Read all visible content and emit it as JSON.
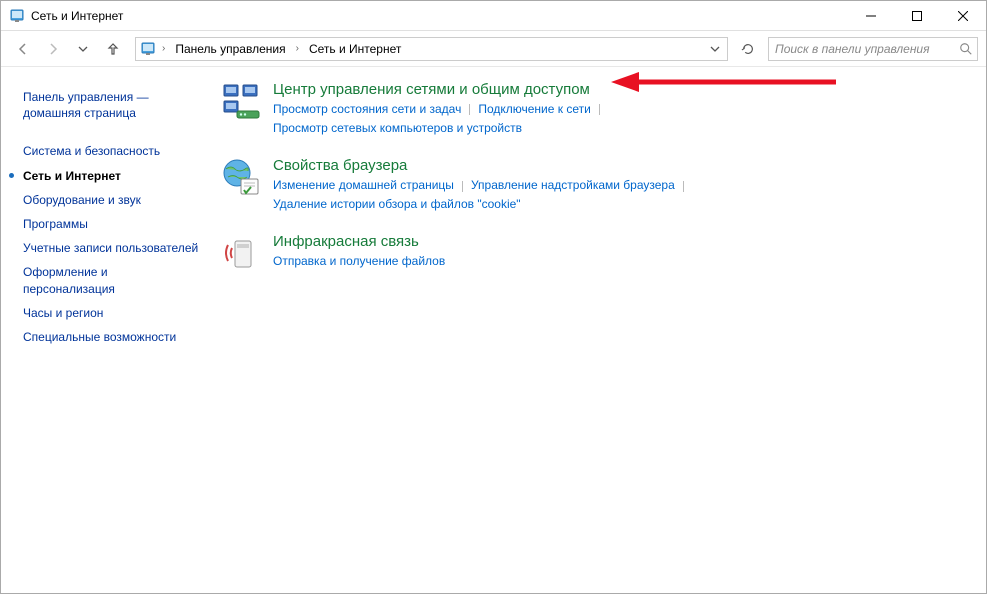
{
  "window": {
    "title": "Сеть и Интернет"
  },
  "breadcrumb": {
    "items": [
      "Панель управления",
      "Сеть и Интернет"
    ]
  },
  "search": {
    "placeholder": "Поиск в панели управления"
  },
  "sidebar": {
    "home": "Панель управления — домашняя страница",
    "items": [
      {
        "label": "Система и безопасность",
        "active": false
      },
      {
        "label": "Сеть и Интернет",
        "active": true
      },
      {
        "label": "Оборудование и звук",
        "active": false
      },
      {
        "label": "Программы",
        "active": false
      },
      {
        "label": "Учетные записи пользователей",
        "active": false
      },
      {
        "label": "Оформление и персонализация",
        "active": false
      },
      {
        "label": "Часы и регион",
        "active": false
      },
      {
        "label": "Специальные возможности",
        "active": false
      }
    ]
  },
  "categories": [
    {
      "title": "Центр управления сетями и общим доступом",
      "links": [
        "Просмотр состояния сети и задач",
        "Подключение к сети",
        "Просмотр сетевых компьютеров и устройств"
      ]
    },
    {
      "title": "Свойства браузера",
      "links": [
        "Изменение домашней страницы",
        "Управление надстройками браузера",
        "Удаление истории обзора и файлов \"cookie\""
      ]
    },
    {
      "title": "Инфракрасная связь",
      "links": [
        "Отправка и получение файлов"
      ]
    }
  ]
}
